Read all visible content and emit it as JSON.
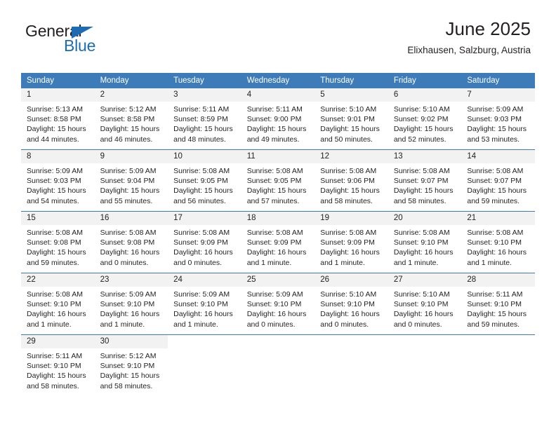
{
  "brand": {
    "name_part1": "General",
    "name_part2": "Blue",
    "triangle_icon": "blue-triangle-icon",
    "accent_color": "#1d6cb3"
  },
  "header": {
    "title": "June 2025",
    "location": "Elixhausen, Salzburg, Austria"
  },
  "theme": {
    "header_bg": "#3d7cb8",
    "daynum_bg": "#f2f2f2",
    "text": "#231f20"
  },
  "calendar": {
    "weekday_headers": [
      "Sunday",
      "Monday",
      "Tuesday",
      "Wednesday",
      "Thursday",
      "Friday",
      "Saturday"
    ],
    "weeks": [
      [
        {
          "day": "1",
          "sunrise": "Sunrise: 5:13 AM",
          "sunset": "Sunset: 8:58 PM",
          "daylight1": "Daylight: 15 hours",
          "daylight2": "and 44 minutes."
        },
        {
          "day": "2",
          "sunrise": "Sunrise: 5:12 AM",
          "sunset": "Sunset: 8:58 PM",
          "daylight1": "Daylight: 15 hours",
          "daylight2": "and 46 minutes."
        },
        {
          "day": "3",
          "sunrise": "Sunrise: 5:11 AM",
          "sunset": "Sunset: 8:59 PM",
          "daylight1": "Daylight: 15 hours",
          "daylight2": "and 48 minutes."
        },
        {
          "day": "4",
          "sunrise": "Sunrise: 5:11 AM",
          "sunset": "Sunset: 9:00 PM",
          "daylight1": "Daylight: 15 hours",
          "daylight2": "and 49 minutes."
        },
        {
          "day": "5",
          "sunrise": "Sunrise: 5:10 AM",
          "sunset": "Sunset: 9:01 PM",
          "daylight1": "Daylight: 15 hours",
          "daylight2": "and 50 minutes."
        },
        {
          "day": "6",
          "sunrise": "Sunrise: 5:10 AM",
          "sunset": "Sunset: 9:02 PM",
          "daylight1": "Daylight: 15 hours",
          "daylight2": "and 52 minutes."
        },
        {
          "day": "7",
          "sunrise": "Sunrise: 5:09 AM",
          "sunset": "Sunset: 9:03 PM",
          "daylight1": "Daylight: 15 hours",
          "daylight2": "and 53 minutes."
        }
      ],
      [
        {
          "day": "8",
          "sunrise": "Sunrise: 5:09 AM",
          "sunset": "Sunset: 9:03 PM",
          "daylight1": "Daylight: 15 hours",
          "daylight2": "and 54 minutes."
        },
        {
          "day": "9",
          "sunrise": "Sunrise: 5:09 AM",
          "sunset": "Sunset: 9:04 PM",
          "daylight1": "Daylight: 15 hours",
          "daylight2": "and 55 minutes."
        },
        {
          "day": "10",
          "sunrise": "Sunrise: 5:08 AM",
          "sunset": "Sunset: 9:05 PM",
          "daylight1": "Daylight: 15 hours",
          "daylight2": "and 56 minutes."
        },
        {
          "day": "11",
          "sunrise": "Sunrise: 5:08 AM",
          "sunset": "Sunset: 9:05 PM",
          "daylight1": "Daylight: 15 hours",
          "daylight2": "and 57 minutes."
        },
        {
          "day": "12",
          "sunrise": "Sunrise: 5:08 AM",
          "sunset": "Sunset: 9:06 PM",
          "daylight1": "Daylight: 15 hours",
          "daylight2": "and 58 minutes."
        },
        {
          "day": "13",
          "sunrise": "Sunrise: 5:08 AM",
          "sunset": "Sunset: 9:07 PM",
          "daylight1": "Daylight: 15 hours",
          "daylight2": "and 58 minutes."
        },
        {
          "day": "14",
          "sunrise": "Sunrise: 5:08 AM",
          "sunset": "Sunset: 9:07 PM",
          "daylight1": "Daylight: 15 hours",
          "daylight2": "and 59 minutes."
        }
      ],
      [
        {
          "day": "15",
          "sunrise": "Sunrise: 5:08 AM",
          "sunset": "Sunset: 9:08 PM",
          "daylight1": "Daylight: 15 hours",
          "daylight2": "and 59 minutes."
        },
        {
          "day": "16",
          "sunrise": "Sunrise: 5:08 AM",
          "sunset": "Sunset: 9:08 PM",
          "daylight1": "Daylight: 16 hours",
          "daylight2": "and 0 minutes."
        },
        {
          "day": "17",
          "sunrise": "Sunrise: 5:08 AM",
          "sunset": "Sunset: 9:09 PM",
          "daylight1": "Daylight: 16 hours",
          "daylight2": "and 0 minutes."
        },
        {
          "day": "18",
          "sunrise": "Sunrise: 5:08 AM",
          "sunset": "Sunset: 9:09 PM",
          "daylight1": "Daylight: 16 hours",
          "daylight2": "and 1 minute."
        },
        {
          "day": "19",
          "sunrise": "Sunrise: 5:08 AM",
          "sunset": "Sunset: 9:09 PM",
          "daylight1": "Daylight: 16 hours",
          "daylight2": "and 1 minute."
        },
        {
          "day": "20",
          "sunrise": "Sunrise: 5:08 AM",
          "sunset": "Sunset: 9:10 PM",
          "daylight1": "Daylight: 16 hours",
          "daylight2": "and 1 minute."
        },
        {
          "day": "21",
          "sunrise": "Sunrise: 5:08 AM",
          "sunset": "Sunset: 9:10 PM",
          "daylight1": "Daylight: 16 hours",
          "daylight2": "and 1 minute."
        }
      ],
      [
        {
          "day": "22",
          "sunrise": "Sunrise: 5:08 AM",
          "sunset": "Sunset: 9:10 PM",
          "daylight1": "Daylight: 16 hours",
          "daylight2": "and 1 minute."
        },
        {
          "day": "23",
          "sunrise": "Sunrise: 5:09 AM",
          "sunset": "Sunset: 9:10 PM",
          "daylight1": "Daylight: 16 hours",
          "daylight2": "and 1 minute."
        },
        {
          "day": "24",
          "sunrise": "Sunrise: 5:09 AM",
          "sunset": "Sunset: 9:10 PM",
          "daylight1": "Daylight: 16 hours",
          "daylight2": "and 1 minute."
        },
        {
          "day": "25",
          "sunrise": "Sunrise: 5:09 AM",
          "sunset": "Sunset: 9:10 PM",
          "daylight1": "Daylight: 16 hours",
          "daylight2": "and 0 minutes."
        },
        {
          "day": "26",
          "sunrise": "Sunrise: 5:10 AM",
          "sunset": "Sunset: 9:10 PM",
          "daylight1": "Daylight: 16 hours",
          "daylight2": "and 0 minutes."
        },
        {
          "day": "27",
          "sunrise": "Sunrise: 5:10 AM",
          "sunset": "Sunset: 9:10 PM",
          "daylight1": "Daylight: 16 hours",
          "daylight2": "and 0 minutes."
        },
        {
          "day": "28",
          "sunrise": "Sunrise: 5:11 AM",
          "sunset": "Sunset: 9:10 PM",
          "daylight1": "Daylight: 15 hours",
          "daylight2": "and 59 minutes."
        }
      ],
      [
        {
          "day": "29",
          "sunrise": "Sunrise: 5:11 AM",
          "sunset": "Sunset: 9:10 PM",
          "daylight1": "Daylight: 15 hours",
          "daylight2": "and 58 minutes."
        },
        {
          "day": "30",
          "sunrise": "Sunrise: 5:12 AM",
          "sunset": "Sunset: 9:10 PM",
          "daylight1": "Daylight: 15 hours",
          "daylight2": "and 58 minutes."
        },
        {
          "day": "",
          "sunrise": "",
          "sunset": "",
          "daylight1": "",
          "daylight2": ""
        },
        {
          "day": "",
          "sunrise": "",
          "sunset": "",
          "daylight1": "",
          "daylight2": ""
        },
        {
          "day": "",
          "sunrise": "",
          "sunset": "",
          "daylight1": "",
          "daylight2": ""
        },
        {
          "day": "",
          "sunrise": "",
          "sunset": "",
          "daylight1": "",
          "daylight2": ""
        },
        {
          "day": "",
          "sunrise": "",
          "sunset": "",
          "daylight1": "",
          "daylight2": ""
        }
      ]
    ]
  }
}
